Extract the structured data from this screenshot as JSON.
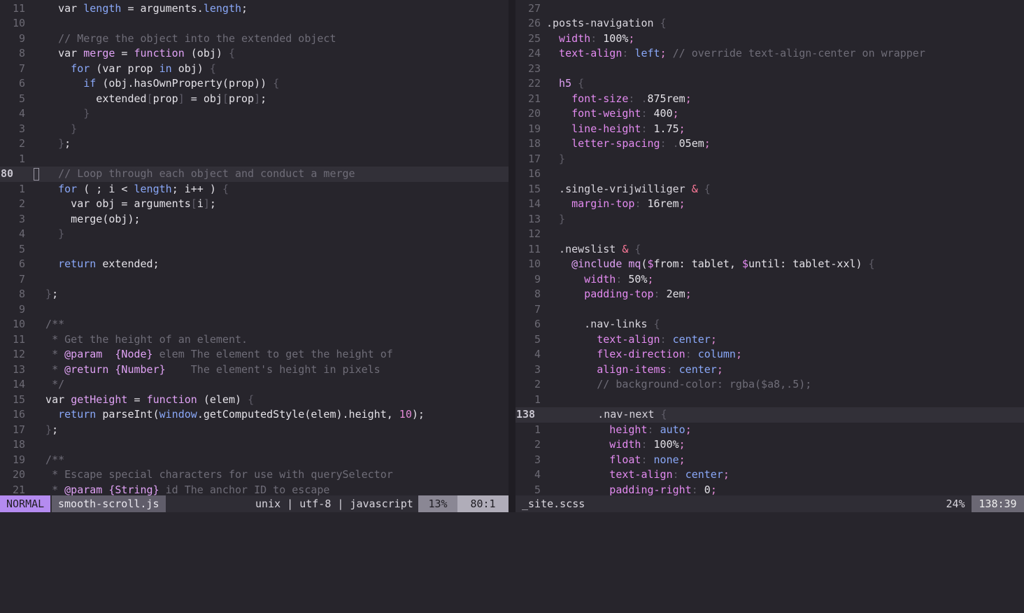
{
  "left_pane": {
    "lines": [
      {
        "num": "11",
        "tokens": [
          [
            "",
            "    var "
          ],
          [
            "kw",
            "length"
          ],
          [
            "",
            " = arguments."
          ],
          [
            "kw",
            "length"
          ],
          [
            "",
            ";"
          ]
        ]
      },
      {
        "num": "10",
        "tokens": []
      },
      {
        "num": "9",
        "tokens": [
          [
            "cm",
            "    // Merge the object into the extended object"
          ]
        ]
      },
      {
        "num": "8",
        "tokens": [
          [
            "",
            "    var "
          ],
          [
            "fn",
            "merge"
          ],
          [
            "",
            " = "
          ],
          [
            "fn",
            "function"
          ],
          [
            "",
            " (obj) "
          ],
          [
            "pu",
            "{"
          ]
        ]
      },
      {
        "num": "7",
        "tokens": [
          [
            "kw",
            "      for"
          ],
          [
            "",
            " (var prop "
          ],
          [
            "kw",
            "in"
          ],
          [
            "",
            " obj) "
          ],
          [
            "pu",
            "{"
          ]
        ]
      },
      {
        "num": "6",
        "tokens": [
          [
            "kw",
            "        if"
          ],
          [
            "",
            " (obj.hasOwnProperty(prop)) "
          ],
          [
            "pu",
            "{"
          ]
        ]
      },
      {
        "num": "5",
        "tokens": [
          [
            "",
            "          extended"
          ],
          [
            "pu",
            "["
          ],
          [
            "",
            "prop"
          ],
          [
            "pu",
            "]"
          ],
          [
            "",
            " = obj"
          ],
          [
            "pu",
            "["
          ],
          [
            "",
            "prop"
          ],
          [
            "pu",
            "]"
          ],
          [
            "",
            ";"
          ]
        ]
      },
      {
        "num": "4",
        "tokens": [
          [
            "pu",
            "        }"
          ]
        ]
      },
      {
        "num": "3",
        "tokens": [
          [
            "pu",
            "      }"
          ]
        ]
      },
      {
        "num": "2",
        "tokens": [
          [
            "pu",
            "    }"
          ],
          [
            "",
            ";"
          ]
        ]
      },
      {
        "num": "1",
        "tokens": []
      },
      {
        "num": "80",
        "current": true,
        "tokens": [
          [
            "cm",
            "    // Loop through each object and conduct a merge"
          ]
        ]
      },
      {
        "num": "1",
        "tokens": [
          [
            "kw",
            "    for"
          ],
          [
            "",
            " ( ; i < "
          ],
          [
            "kw",
            "length"
          ],
          [
            "",
            "; i++ ) "
          ],
          [
            "pu",
            "{"
          ]
        ]
      },
      {
        "num": "2",
        "tokens": [
          [
            "",
            "      var obj = arguments"
          ],
          [
            "pu",
            "["
          ],
          [
            "",
            "i"
          ],
          [
            "pu",
            "]"
          ],
          [
            "",
            ";"
          ]
        ]
      },
      {
        "num": "3",
        "tokens": [
          [
            "",
            "      merge(obj);"
          ]
        ]
      },
      {
        "num": "4",
        "tokens": [
          [
            "pu",
            "    }"
          ]
        ]
      },
      {
        "num": "5",
        "tokens": []
      },
      {
        "num": "6",
        "tokens": [
          [
            "kw",
            "    return"
          ],
          [
            "",
            " extended;"
          ]
        ]
      },
      {
        "num": "7",
        "tokens": []
      },
      {
        "num": "8",
        "tokens": [
          [
            "pu",
            "  }"
          ],
          [
            "",
            ";"
          ]
        ]
      },
      {
        "num": "9",
        "tokens": []
      },
      {
        "num": "10",
        "tokens": [
          [
            "cm",
            "  /**"
          ]
        ]
      },
      {
        "num": "11",
        "tokens": [
          [
            "cm",
            "   * Get the height of an element."
          ]
        ]
      },
      {
        "num": "12",
        "tokens": [
          [
            "cm",
            "   * "
          ],
          [
            "fn",
            "@param"
          ],
          [
            "cm",
            "  "
          ],
          [
            "fn",
            "{Node}"
          ],
          [
            "cm",
            " elem The element to get the height of"
          ]
        ]
      },
      {
        "num": "13",
        "tokens": [
          [
            "cm",
            "   * "
          ],
          [
            "fn",
            "@return"
          ],
          [
            "cm",
            " "
          ],
          [
            "fn",
            "{Number}"
          ],
          [
            "cm",
            "    The element's height in pixels"
          ]
        ]
      },
      {
        "num": "14",
        "tokens": [
          [
            "cm",
            "   */"
          ]
        ]
      },
      {
        "num": "15",
        "tokens": [
          [
            "",
            "  var "
          ],
          [
            "fn",
            "getHeight"
          ],
          [
            "",
            " = "
          ],
          [
            "fn",
            "function"
          ],
          [
            "",
            " (elem) "
          ],
          [
            "pu",
            "{"
          ]
        ]
      },
      {
        "num": "16",
        "tokens": [
          [
            "kw",
            "    return"
          ],
          [
            "",
            " parseInt("
          ],
          [
            "kw",
            "window"
          ],
          [
            "",
            ".getComputedStyle(elem).height, "
          ],
          [
            "nu",
            "10"
          ],
          [
            "",
            ");"
          ]
        ]
      },
      {
        "num": "17",
        "tokens": [
          [
            "pu",
            "  }"
          ],
          [
            "",
            ";"
          ]
        ]
      },
      {
        "num": "18",
        "tokens": []
      },
      {
        "num": "19",
        "tokens": [
          [
            "cm",
            "  /**"
          ]
        ]
      },
      {
        "num": "20",
        "tokens": [
          [
            "cm",
            "   * Escape special characters for use with querySelector"
          ]
        ]
      },
      {
        "num": "21",
        "tokens": [
          [
            "cm",
            "   * "
          ],
          [
            "fn",
            "@param"
          ],
          [
            "cm",
            " "
          ],
          [
            "fn",
            "{String}"
          ],
          [
            "cm",
            " id The anchor ID to escape"
          ]
        ]
      }
    ]
  },
  "right_pane": {
    "lines": [
      {
        "num": "27",
        "tokens": []
      },
      {
        "num": "26",
        "tokens": [
          [
            "sel",
            ".posts-navigation "
          ],
          [
            "pu",
            "{"
          ]
        ]
      },
      {
        "num": "25",
        "tokens": [
          [
            "prop",
            "  width"
          ],
          [
            "pu",
            ": "
          ],
          [
            "",
            "100%"
          ],
          [
            "nu",
            ";"
          ]
        ]
      },
      {
        "num": "24",
        "tokens": [
          [
            "prop",
            "  text-align"
          ],
          [
            "pu",
            ": "
          ],
          [
            "val",
            "left"
          ],
          [
            "nu",
            ";"
          ],
          [
            "cm",
            " // override text-align-center on wrapper"
          ]
        ]
      },
      {
        "num": "23",
        "tokens": []
      },
      {
        "num": "22",
        "tokens": [
          [
            "tag",
            "  h5 "
          ],
          [
            "pu",
            "{"
          ]
        ]
      },
      {
        "num": "21",
        "tokens": [
          [
            "prop",
            "    font-size"
          ],
          [
            "pu",
            ": ."
          ],
          [
            "",
            "875rem"
          ],
          [
            "nu",
            ";"
          ]
        ]
      },
      {
        "num": "20",
        "tokens": [
          [
            "prop",
            "    font-weight"
          ],
          [
            "pu",
            ": "
          ],
          [
            "",
            "400"
          ],
          [
            "nu",
            ";"
          ]
        ]
      },
      {
        "num": "19",
        "tokens": [
          [
            "prop",
            "    line-height"
          ],
          [
            "pu",
            ": "
          ],
          [
            "",
            "1.75"
          ],
          [
            "nu",
            ";"
          ]
        ]
      },
      {
        "num": "18",
        "tokens": [
          [
            "prop",
            "    letter-spacing"
          ],
          [
            "pu",
            ": ."
          ],
          [
            "",
            "05em"
          ],
          [
            "nu",
            ";"
          ]
        ]
      },
      {
        "num": "17",
        "tokens": [
          [
            "pu",
            "  }"
          ]
        ]
      },
      {
        "num": "16",
        "tokens": []
      },
      {
        "num": "15",
        "tokens": [
          [
            "sel",
            "  .single-vrijwilliger "
          ],
          [
            "amp",
            "&"
          ],
          [
            "pu",
            " {"
          ]
        ]
      },
      {
        "num": "14",
        "tokens": [
          [
            "prop",
            "    margin-top"
          ],
          [
            "pu",
            ": "
          ],
          [
            "",
            "16rem"
          ],
          [
            "nu",
            ";"
          ]
        ]
      },
      {
        "num": "13",
        "tokens": [
          [
            "pu",
            "  }"
          ]
        ]
      },
      {
        "num": "12",
        "tokens": []
      },
      {
        "num": "11",
        "tokens": [
          [
            "sel",
            "  .newslist "
          ],
          [
            "amp",
            "&"
          ],
          [
            "pu",
            " {"
          ]
        ]
      },
      {
        "num": "10",
        "tokens": [
          [
            "at",
            "    @include "
          ],
          [
            "fn",
            "mq"
          ],
          [
            "",
            "("
          ],
          [
            "var",
            "$"
          ],
          [
            "",
            "from: tablet, "
          ],
          [
            "var",
            "$"
          ],
          [
            "",
            "until: tablet-xxl) "
          ],
          [
            "pu",
            "{"
          ]
        ]
      },
      {
        "num": "9",
        "tokens": [
          [
            "prop",
            "      width"
          ],
          [
            "pu",
            ": "
          ],
          [
            "",
            "50%"
          ],
          [
            "nu",
            ";"
          ]
        ]
      },
      {
        "num": "8",
        "tokens": [
          [
            "prop",
            "      padding-top"
          ],
          [
            "pu",
            ": "
          ],
          [
            "",
            "2em"
          ],
          [
            "nu",
            ";"
          ]
        ]
      },
      {
        "num": "7",
        "tokens": []
      },
      {
        "num": "6",
        "tokens": [
          [
            "sel",
            "      .nav-links "
          ],
          [
            "pu",
            "{"
          ]
        ]
      },
      {
        "num": "5",
        "tokens": [
          [
            "prop",
            "        text-align"
          ],
          [
            "pu",
            ": "
          ],
          [
            "val",
            "center"
          ],
          [
            "nu",
            ";"
          ]
        ]
      },
      {
        "num": "4",
        "tokens": [
          [
            "prop",
            "        flex-direction"
          ],
          [
            "pu",
            ": "
          ],
          [
            "val",
            "column"
          ],
          [
            "nu",
            ";"
          ]
        ]
      },
      {
        "num": "3",
        "tokens": [
          [
            "prop",
            "        align-items"
          ],
          [
            "pu",
            ": "
          ],
          [
            "val",
            "center"
          ],
          [
            "nu",
            ";"
          ]
        ]
      },
      {
        "num": "2",
        "tokens": [
          [
            "cm",
            "        // background-color: rgba($a8,.5);"
          ]
        ]
      },
      {
        "num": "1",
        "tokens": []
      },
      {
        "num": "138",
        "current": true,
        "tokens": [
          [
            "sel",
            "        .nav-next "
          ],
          [
            "pu",
            "{"
          ]
        ]
      },
      {
        "num": "1",
        "tokens": [
          [
            "prop",
            "          height"
          ],
          [
            "pu",
            ": "
          ],
          [
            "val",
            "auto"
          ],
          [
            "nu",
            ";"
          ]
        ]
      },
      {
        "num": "2",
        "tokens": [
          [
            "prop",
            "          width"
          ],
          [
            "pu",
            ": "
          ],
          [
            "",
            "100%"
          ],
          [
            "nu",
            ";"
          ]
        ]
      },
      {
        "num": "3",
        "tokens": [
          [
            "prop",
            "          float"
          ],
          [
            "pu",
            ": "
          ],
          [
            "val",
            "none"
          ],
          [
            "nu",
            ";"
          ]
        ]
      },
      {
        "num": "4",
        "tokens": [
          [
            "prop",
            "          text-align"
          ],
          [
            "pu",
            ": "
          ],
          [
            "val",
            "center"
          ],
          [
            "nu",
            ";"
          ]
        ]
      },
      {
        "num": "5",
        "tokens": [
          [
            "prop",
            "          padding-right"
          ],
          [
            "pu",
            ": "
          ],
          [
            "",
            "0"
          ],
          [
            "nu",
            ";"
          ]
        ]
      }
    ]
  },
  "status_left": {
    "mode": "NORMAL",
    "filename": "smooth-scroll.js",
    "format": "unix | utf-8 | javascript",
    "percent": "13%",
    "position": "80:1"
  },
  "status_right": {
    "filename": "_site.scss",
    "percent": "24%",
    "position": "138:39"
  }
}
